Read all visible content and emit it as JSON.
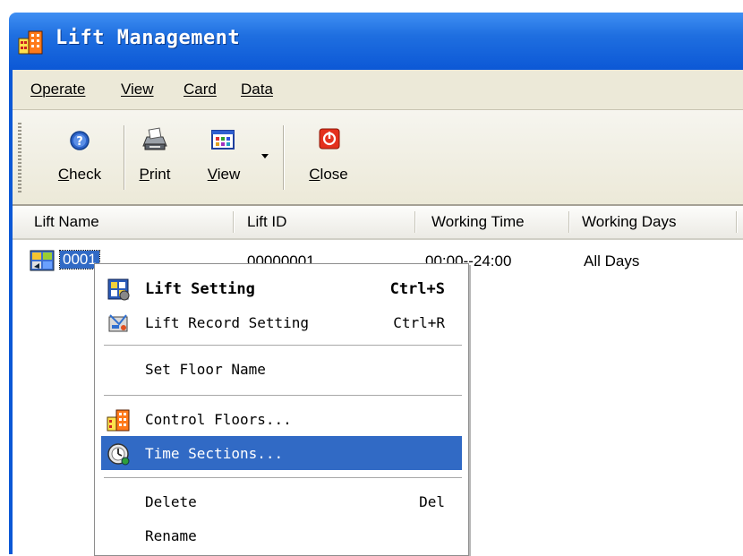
{
  "window": {
    "title": "Lift Management"
  },
  "menubar": {
    "items": [
      "Operate",
      "View",
      "Card",
      "Data"
    ]
  },
  "toolbar": {
    "check_label": "Check",
    "print_label": "Print",
    "view_label": "View",
    "close_label": "Close"
  },
  "list": {
    "columns": [
      "Lift Name",
      "Lift ID",
      "Working Time",
      "Working Days"
    ],
    "rows": [
      {
        "name": "0001",
        "id": "00000001",
        "working_time": "00:00--24:00",
        "working_days": "All Days"
      }
    ]
  },
  "context_menu": {
    "items": [
      {
        "label": "Lift Setting",
        "shortcut": "Ctrl+S",
        "icon": "lift-setting-icon"
      },
      {
        "label": "Lift Record Setting",
        "shortcut": "Ctrl+R",
        "icon": "record-setting-icon"
      },
      {
        "label": "Set Floor Name",
        "shortcut": ""
      },
      {
        "label": "Control Floors...",
        "shortcut": "",
        "icon": "control-floors-icon"
      },
      {
        "label": "Time Sections...",
        "shortcut": "",
        "icon": "time-sections-icon"
      },
      {
        "label": "Delete",
        "shortcut": "Del"
      },
      {
        "label": "Rename",
        "shortcut": ""
      }
    ]
  },
  "colors": {
    "titlebar": "#0c58d6",
    "selection": "#316ac5",
    "menubar_bg": "#ece9d8"
  }
}
